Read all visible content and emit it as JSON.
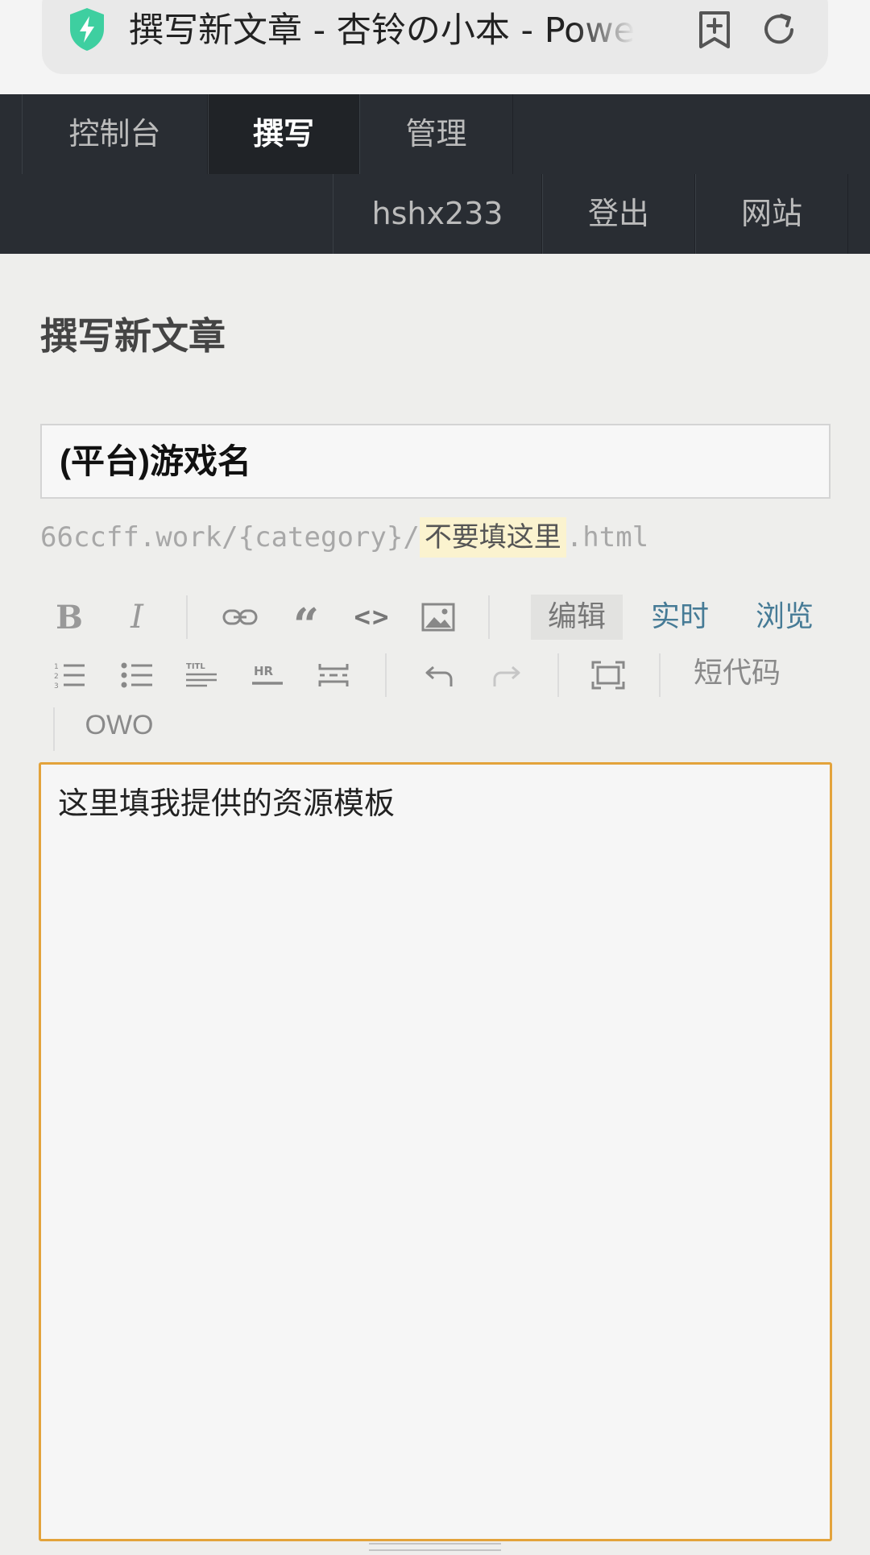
{
  "browser": {
    "tab_title": "撰写新文章 - 杏铃の小本 - Powered by Typecho",
    "shield_color": "#3ecfa0"
  },
  "nav": {
    "primary": [
      {
        "label": "控制台",
        "active": false
      },
      {
        "label": "撰写",
        "active": true
      },
      {
        "label": "管理",
        "active": false
      }
    ],
    "secondary": [
      {
        "label": "hshx233"
      },
      {
        "label": "登出"
      },
      {
        "label": "网站"
      }
    ]
  },
  "main": {
    "page_title": "撰写新文章",
    "title_field_value": "(平台)游戏名",
    "slug": {
      "prefix": "66ccff.work/{category}/",
      "value": "不要填这里",
      "suffix": ".html"
    }
  },
  "toolbar": {
    "icons": [
      "bold-icon",
      "italic-icon",
      "link-icon",
      "quote-icon",
      "code-icon",
      "image-icon",
      "ordered-list-icon",
      "unordered-list-icon",
      "heading-icon",
      "hr-icon",
      "more-icon",
      "undo-icon",
      "redo-icon",
      "fullscreen-icon"
    ],
    "bold_glyph": "B",
    "italic_glyph": "I",
    "quote_glyph": "“",
    "code_glyph": "<>",
    "mode_edit": "编辑",
    "mode_live": "实时",
    "mode_preview": "浏览",
    "shortcode_label": "短代码",
    "owo_label": "OWO",
    "accent_color": "#467b96"
  },
  "editor": {
    "content": "这里填我提供的资源模板",
    "border_color": "#e3a33b"
  }
}
